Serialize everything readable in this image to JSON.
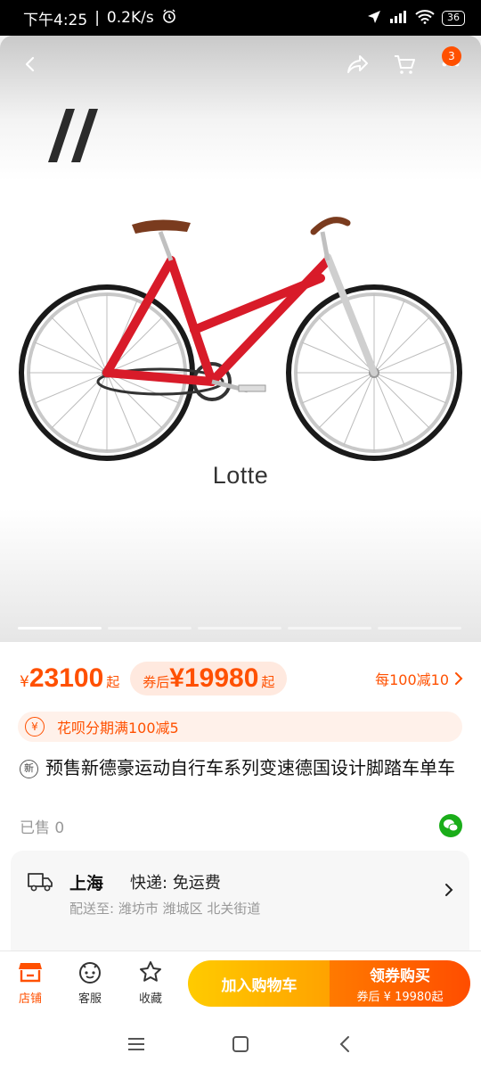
{
  "status_bar": {
    "time": "下午4:25",
    "speed": "0.2K/s",
    "battery": "36"
  },
  "hero": {
    "model_name": "Lotte",
    "cart_badge": "3",
    "image_count": 5,
    "active_index": 0,
    "colors": {
      "frame": "#d81b29",
      "saddle": "#7a3b1e"
    }
  },
  "price": {
    "currency": "¥",
    "value": "23100",
    "suffix": "起",
    "coupon_label": "券后",
    "coupon_value": "¥19980",
    "coupon_suffix": "起",
    "discount": "每100减10"
  },
  "huabei": {
    "icon_text": "¥",
    "text": "花呗分期满100减5"
  },
  "product": {
    "new_tag": "新",
    "title": "预售新德豪运动自行车系列变速德国设计脚踏车单车",
    "sold": "已售 0"
  },
  "shipping": {
    "city": "上海",
    "express": "快递: 免运费",
    "address": "配送至: 潍坊市 潍城区 北关街道"
  },
  "bottom_bar": {
    "store": "店铺",
    "service": "客服",
    "favorite": "收藏",
    "add_cart": "加入购物车",
    "buy": "领券购买",
    "buy_sub": "券后 ¥ 19980起"
  },
  "accent_color": "#ff5000"
}
